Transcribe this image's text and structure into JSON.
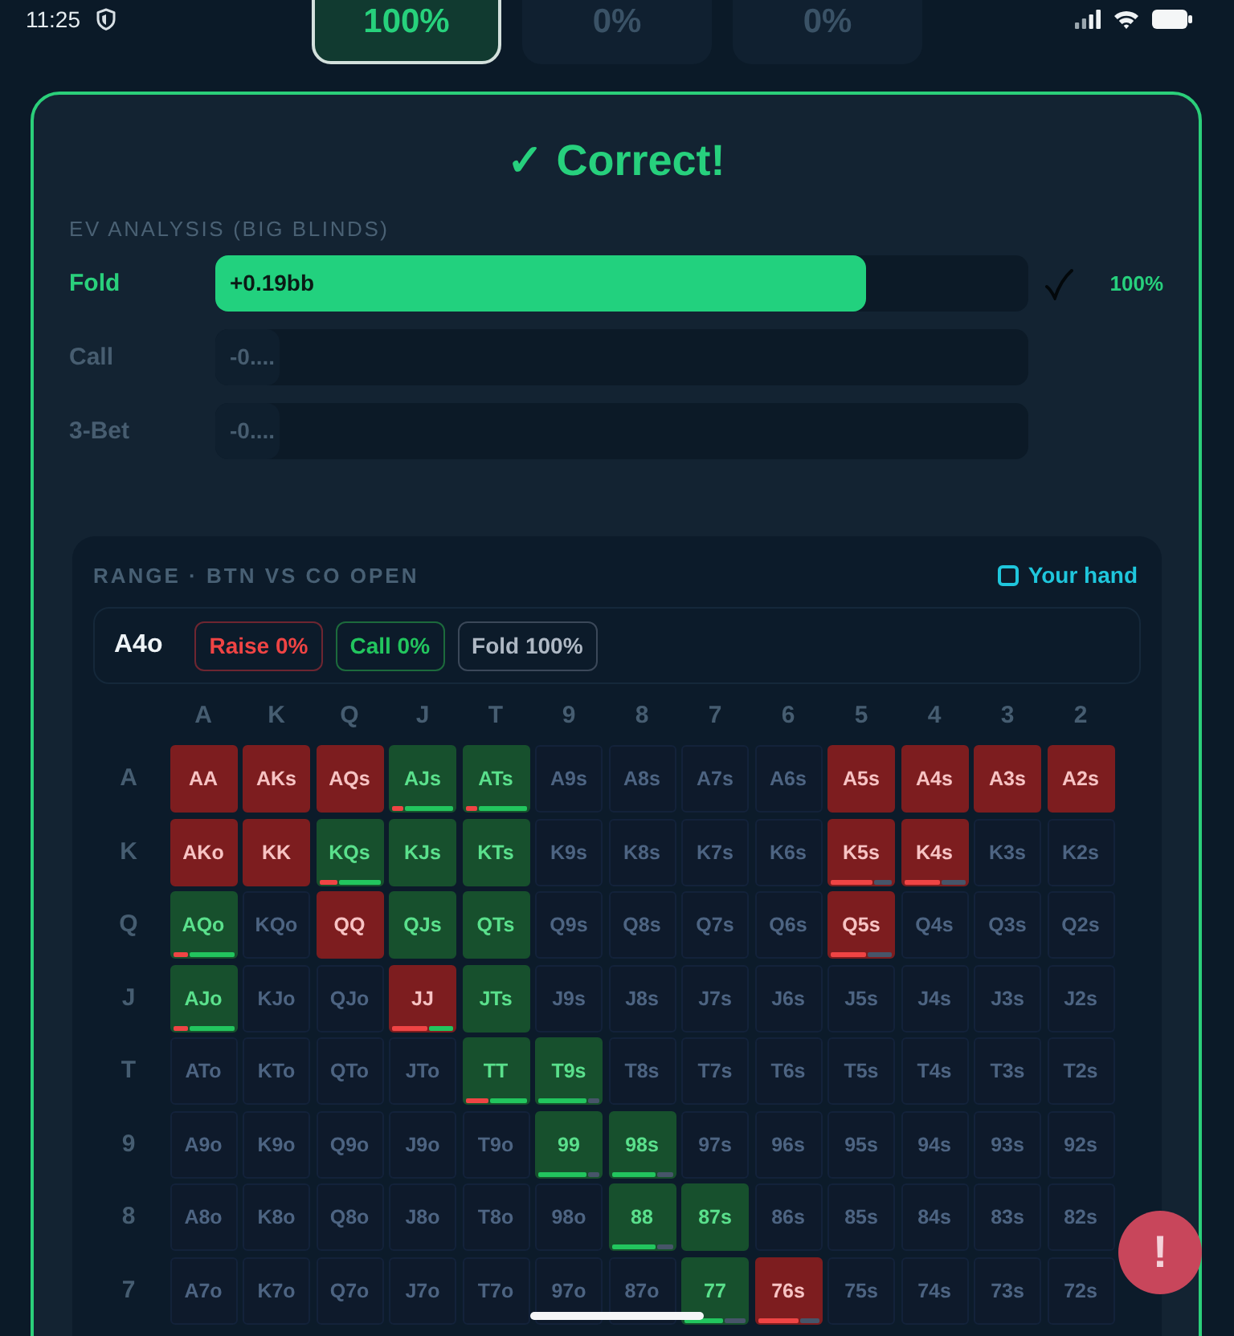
{
  "status_bar": {
    "time": "11:25"
  },
  "score_tabs": [
    {
      "label": "100%",
      "selected": true
    },
    {
      "label": "0%",
      "selected": false
    },
    {
      "label": "0%",
      "selected": false
    }
  ],
  "result": {
    "title": "✓ Correct!"
  },
  "ev_analysis": {
    "heading": "EV ANALYSIS (BIG BLINDS)",
    "rows": [
      {
        "label": "Fold",
        "value": "+0.19bb",
        "level": 0.8,
        "correct": true,
        "frequency": "100%"
      },
      {
        "label": "Call",
        "value": "-0....",
        "level": 0.08,
        "correct": false
      },
      {
        "label": "3-Bet",
        "value": "-0....",
        "level": 0.08,
        "correct": false
      }
    ]
  },
  "range": {
    "title": "RANGE · BTN VS CO OPEN",
    "legend": "Your hand",
    "hand": {
      "name": "A4o",
      "badges": [
        {
          "kind": "raise",
          "label": "Raise 0%"
        },
        {
          "kind": "call",
          "label": "Call 0%"
        },
        {
          "kind": "fold",
          "label": "Fold 100%"
        }
      ]
    },
    "columns": [
      "A",
      "K",
      "Q",
      "J",
      "T",
      "9",
      "8",
      "7",
      "6",
      "5",
      "4",
      "3",
      "2"
    ],
    "rows": [
      {
        "label": "A",
        "cells": [
          {
            "hand": "AA",
            "kind": "raise"
          },
          {
            "hand": "AKs",
            "kind": "raise"
          },
          {
            "hand": "AQs",
            "kind": "raise"
          },
          {
            "hand": "AJs",
            "kind": "call",
            "mix": [
              {
                "kind": "raise",
                "level": 0.2
              },
              {
                "kind": "call",
                "level": 0.8
              }
            ]
          },
          {
            "hand": "ATs",
            "kind": "call",
            "mix": [
              {
                "kind": "raise",
                "level": 0.2
              },
              {
                "kind": "call",
                "level": 0.8
              }
            ]
          },
          {
            "hand": "A9s",
            "kind": "fold"
          },
          {
            "hand": "A8s",
            "kind": "fold"
          },
          {
            "hand": "A7s",
            "kind": "fold"
          },
          {
            "hand": "A6s",
            "kind": "fold"
          },
          {
            "hand": "A5s",
            "kind": "raise"
          },
          {
            "hand": "A4s",
            "kind": "raise"
          },
          {
            "hand": "A3s",
            "kind": "raise"
          },
          {
            "hand": "A2s",
            "kind": "raise"
          }
        ]
      },
      {
        "label": "K",
        "cells": [
          {
            "hand": "AKo",
            "kind": "raise"
          },
          {
            "hand": "KK",
            "kind": "raise"
          },
          {
            "hand": "KQs",
            "kind": "call",
            "mix": [
              {
                "kind": "raise",
                "level": 0.3
              },
              {
                "kind": "call",
                "level": 0.7
              }
            ]
          },
          {
            "hand": "KJs",
            "kind": "call"
          },
          {
            "hand": "KTs",
            "kind": "call"
          },
          {
            "hand": "K9s",
            "kind": "fold"
          },
          {
            "hand": "K8s",
            "kind": "fold"
          },
          {
            "hand": "K7s",
            "kind": "fold"
          },
          {
            "hand": "K6s",
            "kind": "fold"
          },
          {
            "hand": "K5s",
            "kind": "raise",
            "mix": [
              {
                "kind": "raise",
                "level": 0.7
              },
              {
                "kind": "fold",
                "level": 0.3
              }
            ]
          },
          {
            "hand": "K4s",
            "kind": "raise",
            "mix": [
              {
                "kind": "raise",
                "level": 0.6
              },
              {
                "kind": "fold",
                "level": 0.4
              }
            ]
          },
          {
            "hand": "K3s",
            "kind": "fold"
          },
          {
            "hand": "K2s",
            "kind": "fold"
          }
        ]
      },
      {
        "label": "Q",
        "cells": [
          {
            "hand": "AQo",
            "kind": "call",
            "mix": [
              {
                "kind": "raise",
                "level": 0.25
              },
              {
                "kind": "call",
                "level": 0.75
              }
            ]
          },
          {
            "hand": "KQo",
            "kind": "fold"
          },
          {
            "hand": "QQ",
            "kind": "raise"
          },
          {
            "hand": "QJs",
            "kind": "call"
          },
          {
            "hand": "QTs",
            "kind": "call"
          },
          {
            "hand": "Q9s",
            "kind": "fold"
          },
          {
            "hand": "Q8s",
            "kind": "fold"
          },
          {
            "hand": "Q7s",
            "kind": "fold"
          },
          {
            "hand": "Q6s",
            "kind": "fold"
          },
          {
            "hand": "Q5s",
            "kind": "raise",
            "mix": [
              {
                "kind": "raise",
                "level": 0.6
              },
              {
                "kind": "fold",
                "level": 0.4
              }
            ]
          },
          {
            "hand": "Q4s",
            "kind": "fold"
          },
          {
            "hand": "Q3s",
            "kind": "fold"
          },
          {
            "hand": "Q2s",
            "kind": "fold"
          }
        ]
      },
      {
        "label": "J",
        "cells": [
          {
            "hand": "AJo",
            "kind": "call",
            "mix": [
              {
                "kind": "raise",
                "level": 0.25
              },
              {
                "kind": "call",
                "level": 0.75
              }
            ]
          },
          {
            "hand": "KJo",
            "kind": "fold"
          },
          {
            "hand": "QJo",
            "kind": "fold"
          },
          {
            "hand": "JJ",
            "kind": "raise",
            "mix": [
              {
                "kind": "raise",
                "level": 0.6
              },
              {
                "kind": "call",
                "level": 0.4
              }
            ]
          },
          {
            "hand": "JTs",
            "kind": "call"
          },
          {
            "hand": "J9s",
            "kind": "fold"
          },
          {
            "hand": "J8s",
            "kind": "fold"
          },
          {
            "hand": "J7s",
            "kind": "fold"
          },
          {
            "hand": "J6s",
            "kind": "fold"
          },
          {
            "hand": "J5s",
            "kind": "fold"
          },
          {
            "hand": "J4s",
            "kind": "fold"
          },
          {
            "hand": "J3s",
            "kind": "fold"
          },
          {
            "hand": "J2s",
            "kind": "fold"
          }
        ]
      },
      {
        "label": "T",
        "cells": [
          {
            "hand": "ATo",
            "kind": "fold"
          },
          {
            "hand": "KTo",
            "kind": "fold"
          },
          {
            "hand": "QTo",
            "kind": "fold"
          },
          {
            "hand": "JTo",
            "kind": "fold"
          },
          {
            "hand": "TT",
            "kind": "call",
            "mix": [
              {
                "kind": "raise",
                "level": 0.4
              },
              {
                "kind": "call",
                "level": 0.6
              }
            ]
          },
          {
            "hand": "T9s",
            "kind": "call",
            "mix": [
              {
                "kind": "call",
                "level": 0.8
              },
              {
                "kind": "fold",
                "level": 0.2
              }
            ]
          },
          {
            "hand": "T8s",
            "kind": "fold"
          },
          {
            "hand": "T7s",
            "kind": "fold"
          },
          {
            "hand": "T6s",
            "kind": "fold"
          },
          {
            "hand": "T5s",
            "kind": "fold"
          },
          {
            "hand": "T4s",
            "kind": "fold"
          },
          {
            "hand": "T3s",
            "kind": "fold"
          },
          {
            "hand": "T2s",
            "kind": "fold"
          }
        ]
      },
      {
        "label": "9",
        "cells": [
          {
            "hand": "A9o",
            "kind": "fold"
          },
          {
            "hand": "K9o",
            "kind": "fold"
          },
          {
            "hand": "Q9o",
            "kind": "fold"
          },
          {
            "hand": "J9o",
            "kind": "fold"
          },
          {
            "hand": "T9o",
            "kind": "fold"
          },
          {
            "hand": "99",
            "kind": "call",
            "mix": [
              {
                "kind": "call",
                "level": 0.8
              },
              {
                "kind": "fold",
                "level": 0.2
              }
            ]
          },
          {
            "hand": "98s",
            "kind": "call",
            "mix": [
              {
                "kind": "call",
                "level": 0.75
              },
              {
                "kind": "fold",
                "level": 0.25
              }
            ]
          },
          {
            "hand": "97s",
            "kind": "fold"
          },
          {
            "hand": "96s",
            "kind": "fold"
          },
          {
            "hand": "95s",
            "kind": "fold"
          },
          {
            "hand": "94s",
            "kind": "fold"
          },
          {
            "hand": "93s",
            "kind": "fold"
          },
          {
            "hand": "92s",
            "kind": "fold"
          }
        ]
      },
      {
        "label": "8",
        "cells": [
          {
            "hand": "A8o",
            "kind": "fold"
          },
          {
            "hand": "K8o",
            "kind": "fold"
          },
          {
            "hand": "Q8o",
            "kind": "fold"
          },
          {
            "hand": "J8o",
            "kind": "fold"
          },
          {
            "hand": "T8o",
            "kind": "fold"
          },
          {
            "hand": "98o",
            "kind": "fold"
          },
          {
            "hand": "88",
            "kind": "call",
            "mix": [
              {
                "kind": "call",
                "level": 0.75
              },
              {
                "kind": "fold",
                "level": 0.25
              }
            ]
          },
          {
            "hand": "87s",
            "kind": "call"
          },
          {
            "hand": "86s",
            "kind": "fold"
          },
          {
            "hand": "85s",
            "kind": "fold"
          },
          {
            "hand": "84s",
            "kind": "fold"
          },
          {
            "hand": "83s",
            "kind": "fold"
          },
          {
            "hand": "82s",
            "kind": "fold"
          }
        ]
      },
      {
        "label": "7",
        "cells": [
          {
            "hand": "A7o",
            "kind": "fold"
          },
          {
            "hand": "K7o",
            "kind": "fold"
          },
          {
            "hand": "Q7o",
            "kind": "fold"
          },
          {
            "hand": "J7o",
            "kind": "fold"
          },
          {
            "hand": "T7o",
            "kind": "fold"
          },
          {
            "hand": "97o",
            "kind": "fold"
          },
          {
            "hand": "87o",
            "kind": "fold"
          },
          {
            "hand": "77",
            "kind": "call",
            "mix": [
              {
                "kind": "call",
                "level": 0.65
              },
              {
                "kind": "fold",
                "level": 0.35
              }
            ]
          },
          {
            "hand": "76s",
            "kind": "raise",
            "mix": [
              {
                "kind": "raise",
                "level": 0.7
              },
              {
                "kind": "fold",
                "level": 0.3
              }
            ]
          },
          {
            "hand": "75s",
            "kind": "fold"
          },
          {
            "hand": "74s",
            "kind": "fold"
          },
          {
            "hand": "73s",
            "kind": "fold"
          },
          {
            "hand": "72s",
            "kind": "fold"
          }
        ]
      }
    ]
  },
  "fab": {
    "label": "!"
  }
}
